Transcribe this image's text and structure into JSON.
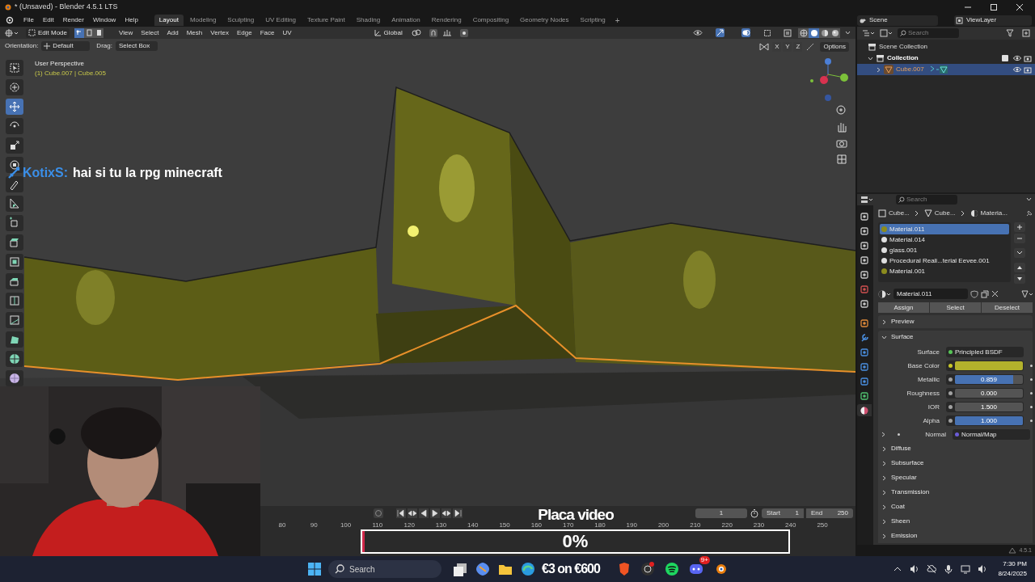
{
  "window": {
    "title": "* (Unsaved) - Blender 4.5.1 LTS"
  },
  "menus": [
    "File",
    "Edit",
    "Render",
    "Window",
    "Help"
  ],
  "workspaces": [
    {
      "label": "Layout",
      "selected": true
    },
    {
      "label": "Modeling",
      "selected": false
    },
    {
      "label": "Sculpting",
      "selected": false
    },
    {
      "label": "UV Editing",
      "selected": false
    },
    {
      "label": "Texture Paint",
      "selected": false
    },
    {
      "label": "Shading",
      "selected": false
    },
    {
      "label": "Animation",
      "selected": false
    },
    {
      "label": "Rendering",
      "selected": false
    },
    {
      "label": "Compositing",
      "selected": false
    },
    {
      "label": "Geometry Nodes",
      "selected": false
    },
    {
      "label": "Scripting",
      "selected": false
    }
  ],
  "add_workspace": "+",
  "scene": "Scene",
  "view_layer": "ViewLayer",
  "header": {
    "mode": "Edit Mode",
    "select_modes": [
      {
        "selected": true
      },
      {
        "selected": false
      },
      {
        "selected": false
      }
    ],
    "menus": [
      "View",
      "Select",
      "Add",
      "Mesh",
      "Vertex",
      "Edge",
      "Face",
      "UV"
    ],
    "orientation": "Global",
    "shading_modes": [
      {
        "selected": false
      },
      {
        "selected": true
      },
      {
        "selected": false
      },
      {
        "selected": false
      }
    ]
  },
  "tool_settings": {
    "orientation_label": "Orientation:",
    "orientation": "Default",
    "drag_label": "Drag:",
    "drag": "Select Box",
    "mirror_axes": [
      "X",
      "Y",
      "Z"
    ],
    "options": "Options"
  },
  "viewport": {
    "view_name": "User Perspective",
    "object_info": "(1) Cube.007 | Cube.005",
    "tools": [
      {
        "selected": false
      },
      {
        "selected": false
      },
      {
        "selected": true
      },
      {
        "selected": false
      },
      {
        "selected": false
      },
      {
        "selected": false
      },
      {
        "selected": false
      },
      {
        "selected": false
      },
      {
        "selected": false
      },
      {
        "selected": false
      },
      {
        "selected": false
      },
      {
        "selected": false
      },
      {
        "selected": false
      },
      {
        "selected": false
      },
      {
        "selected": false
      },
      {
        "selected": false
      },
      {
        "selected": false
      }
    ]
  },
  "chat": {
    "user": "KotixS:",
    "message": "hai si tu la rpg minecraft"
  },
  "stream_overlay": {
    "title": "Placa video",
    "percent": "0%",
    "level": 0
  },
  "timeline": {
    "current_frame": "1",
    "start_label": "Start",
    "start": "1",
    "end_label": "End",
    "end": "250",
    "ticks": [
      "80",
      "90",
      "100",
      "110",
      "120",
      "130",
      "140",
      "150",
      "160",
      "170",
      "180",
      "190",
      "200",
      "210",
      "220",
      "230",
      "240",
      "250"
    ]
  },
  "outliner": {
    "search_placeholder": "Search",
    "items": [
      {
        "label": "Scene Collection",
        "selected": false,
        "children": [
          {
            "label": "Collection",
            "selected": false,
            "expanded": true,
            "checked": true,
            "children": [
              {
                "label": "Cube.007",
                "selected": true,
                "expanded": false
              }
            ]
          }
        ]
      }
    ]
  },
  "properties": {
    "search_placeholder": "Search",
    "tabs": [
      {
        "selected": false
      },
      {
        "selected": false
      },
      {
        "selected": false
      },
      {
        "selected": false
      },
      {
        "selected": false
      },
      {
        "selected": false
      },
      {
        "selected": false
      },
      {
        "selected": false
      },
      {
        "selected": false
      },
      {
        "selected": false
      },
      {
        "selected": false
      },
      {
        "selected": false
      },
      {
        "selected": false
      },
      {
        "selected": true
      }
    ],
    "breadcrumb": [
      "Cube...",
      "Cube...",
      "Materia..."
    ],
    "materials": [
      {
        "name": "Material.011",
        "selected": true,
        "color": "#8c8c1e"
      },
      {
        "name": "Material.014",
        "selected": false,
        "color": "#e0e0e0"
      },
      {
        "name": "glass.001",
        "selected": false,
        "color": "#e0e0e0"
      },
      {
        "name": "Procedural Reali...terial Eevee.001",
        "selected": false,
        "color": "#e0e0e0"
      },
      {
        "name": "Material.001",
        "selected": false,
        "color": "#8c8c1e"
      }
    ],
    "material_name": "Material.011",
    "actions": [
      "Assign",
      "Select",
      "Deselect"
    ],
    "panels": [
      {
        "label": "Preview",
        "expanded": false
      },
      {
        "label": "Surface",
        "expanded": true
      }
    ],
    "fields": [
      {
        "kind": "shader",
        "label": "Surface",
        "value": "Principled BSDF"
      },
      {
        "kind": "swatch",
        "label": "Base Color",
        "color": "#b3b22c"
      },
      {
        "kind": "slider",
        "label": "Metallic",
        "value": "0.859",
        "level": 0.859
      },
      {
        "kind": "slider",
        "label": "Roughness",
        "value": "0.000",
        "level": 0
      },
      {
        "kind": "number",
        "label": "IOR",
        "value": "1.500"
      },
      {
        "kind": "slider",
        "label": "Alpha",
        "value": "1.000",
        "level": 1
      },
      {
        "kind": "link",
        "label": "Normal",
        "value": "Normal/Map"
      }
    ],
    "subpanels": [
      "Diffuse",
      "Subsurface",
      "Specular",
      "Transmission",
      "Coat",
      "Sheen",
      "Emission"
    ]
  },
  "version": "4.5.1",
  "taskbar": {
    "search_placeholder": "Search",
    "promo": "€3 on €600",
    "badge": "9+",
    "time": "7:30 PM",
    "date": "8/24/2025"
  }
}
